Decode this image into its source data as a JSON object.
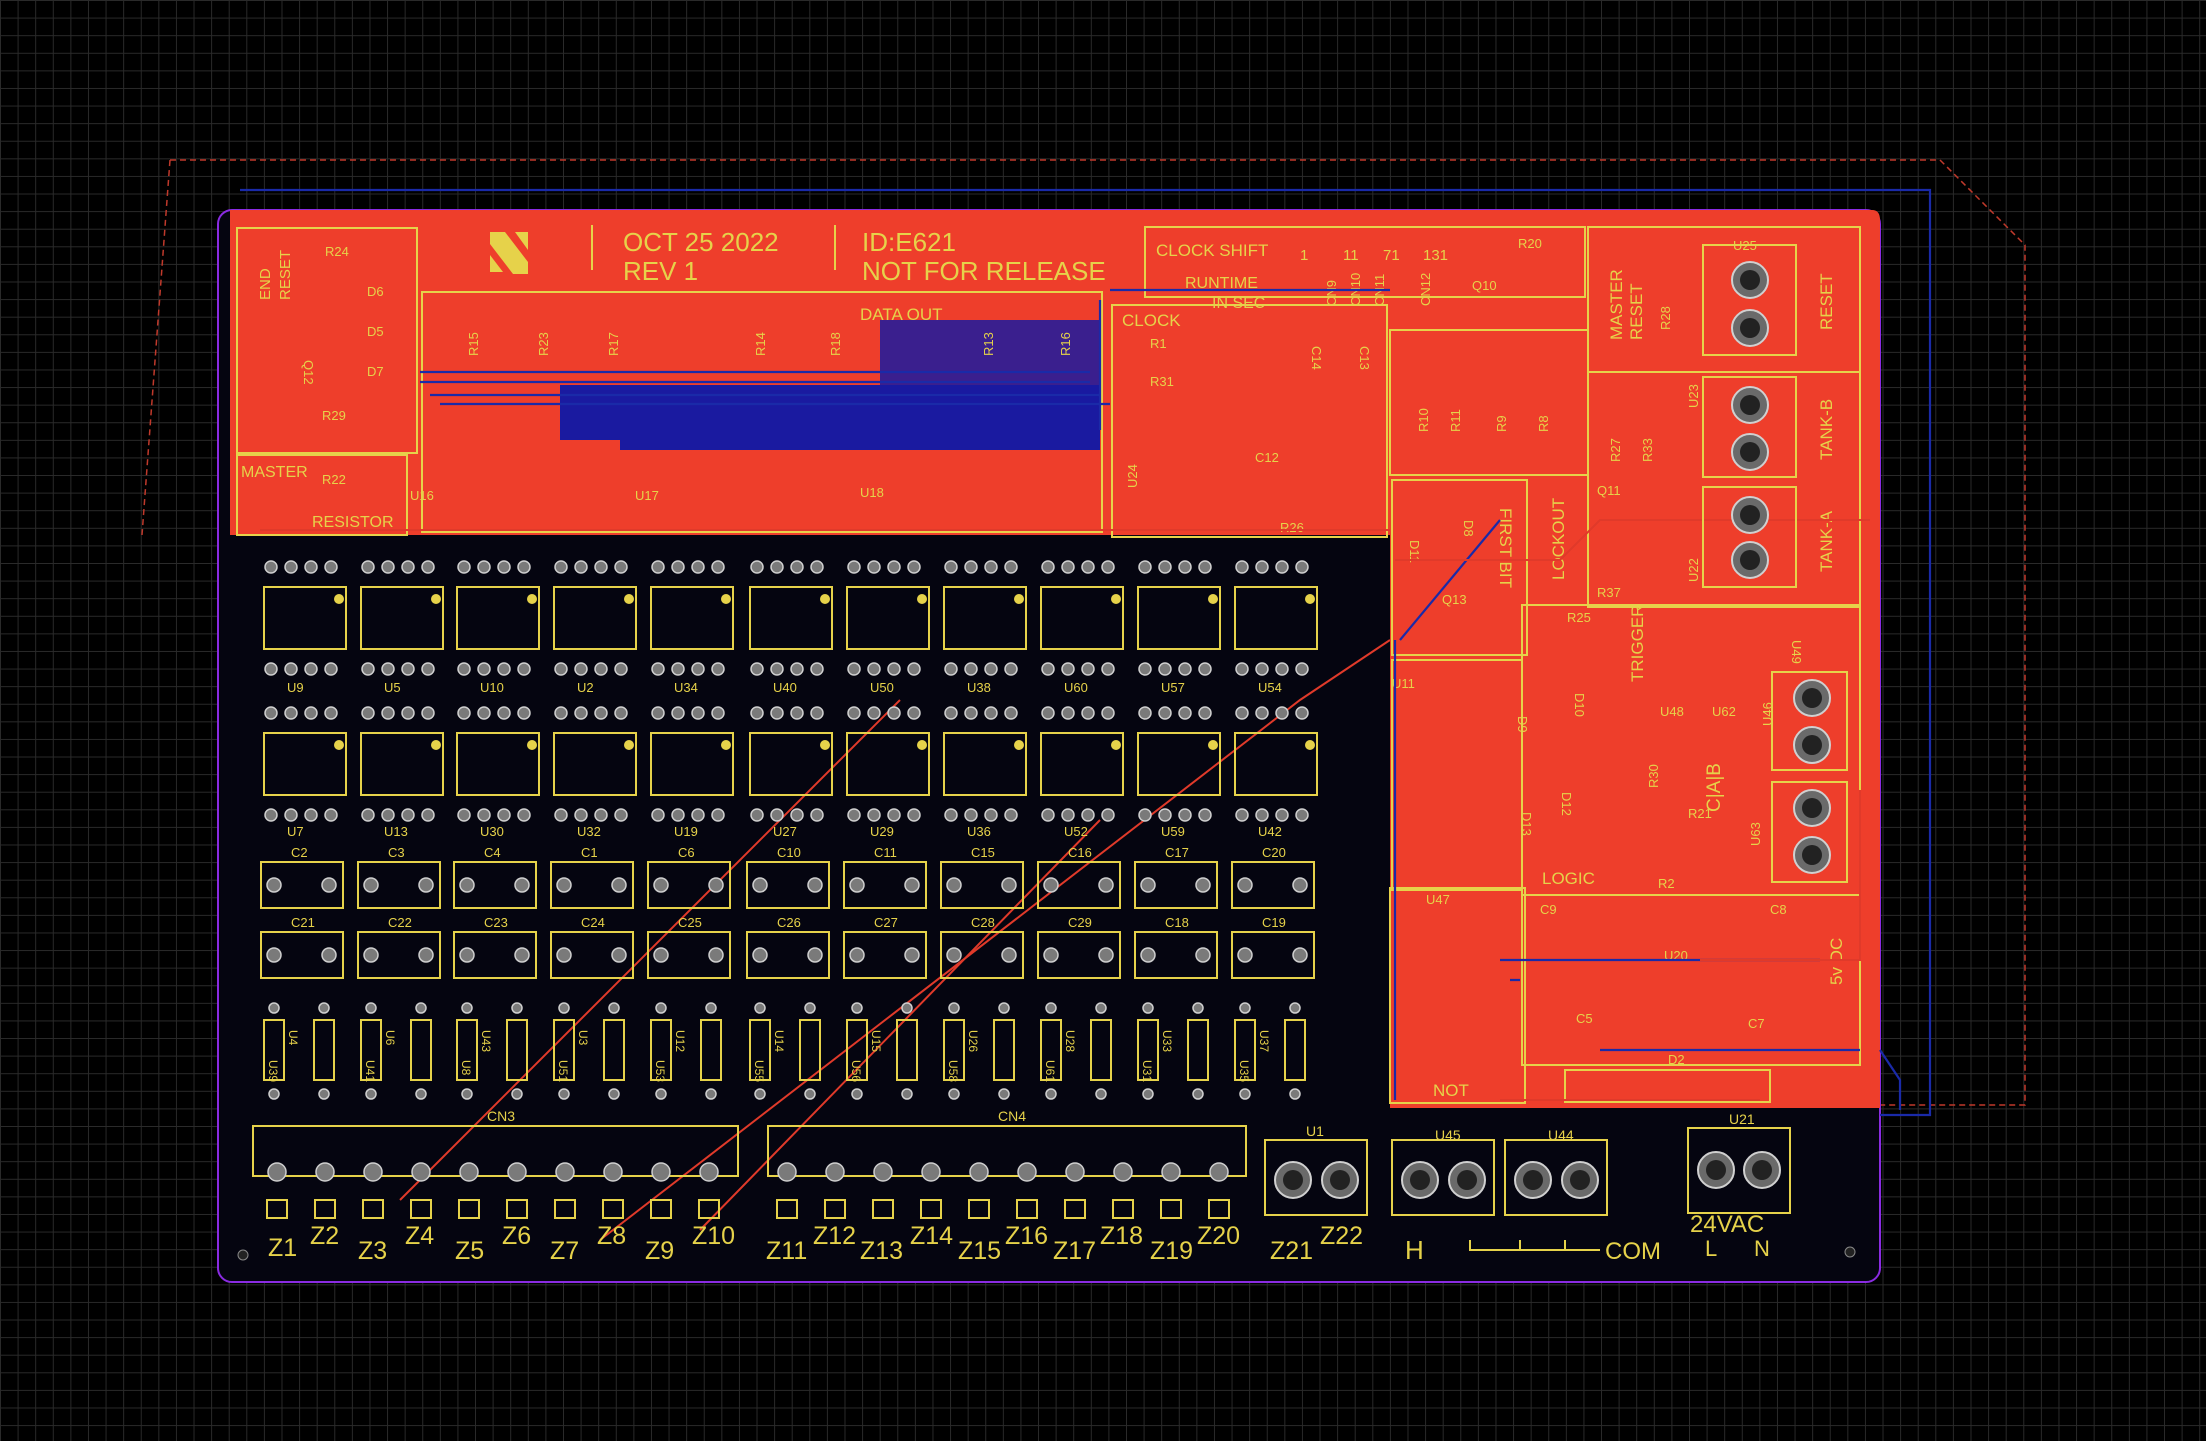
{
  "header": {
    "date": "OCT 25 2022",
    "rev": "REV 1",
    "id": "ID:E621",
    "release": "NOT FOR RELEASE"
  },
  "blocks": {
    "end_reset_a": "END",
    "end_reset_b": "RESET",
    "master_resistor_a": "MASTER",
    "master_resistor_b": "RESISTOR",
    "data_out": "DATA OUT",
    "clock_shift": "CLOCK SHIFT",
    "runtime_a": "RUNTIME",
    "runtime_b": "IN SEC",
    "runtime_values": [
      "1",
      "11",
      "71",
      "131"
    ],
    "clock": "CLOCK",
    "master_reset_a": "MASTER",
    "master_reset_b": "RESET",
    "reset": "RESET",
    "tank_b": "TANK-B",
    "tank_a": "TANK-A",
    "lockout": "LOCKOUT",
    "first_bit": "FIRST BIT",
    "trigger": "TRIGGER",
    "logic": "LOGIC",
    "not": "NOT",
    "vdc": "5v DC",
    "cab": "C|A|B"
  },
  "top_refs": {
    "r24": "R24",
    "d6": "D6",
    "d5": "D5",
    "d7": "D7",
    "q12": "Q12",
    "r29": "R29",
    "r22": "R22",
    "r15": "R15",
    "r23": "R23",
    "r17": "R17",
    "r14": "R14",
    "r18": "R18",
    "r13": "R13",
    "r16": "R16",
    "u16": "U16",
    "u17": "U17",
    "u18": "U18",
    "cn9": "CN9",
    "cn10": "CN10",
    "cn11": "CN11",
    "cn12": "CN12",
    "q10": "Q10",
    "r20": "R20",
    "r1": "R1",
    "r31": "R31",
    "c14": "C14",
    "c13": "C13",
    "c12": "C12",
    "u24": "U24",
    "r26": "R26",
    "r10": "R10",
    "r11": "R11",
    "r9": "R9",
    "r8": "R8",
    "r28": "R28",
    "u25": "U25",
    "r27": "R27",
    "r33": "R33",
    "u23": "U23",
    "q11": "Q11",
    "r37": "R37",
    "u22": "U22",
    "d11": "D11",
    "d8": "D8",
    "q13": "Q13",
    "r25": "R25",
    "u49": "U49",
    "u48": "U48",
    "u62": "U62",
    "u11": "U11",
    "d9": "D9",
    "d10": "D10",
    "d13": "D13",
    "d12": "D12",
    "u46": "U46",
    "r30": "R30",
    "r21": "R21",
    "r2": "R2",
    "u63": "U63",
    "u47": "U47",
    "c9": "C9",
    "c8": "C8",
    "u20": "U20",
    "c5": "C5",
    "c7": "C7",
    "d2": "D2"
  },
  "relay_row1_labels": [
    "U9",
    "U5",
    "U10",
    "U2",
    "U34",
    "U40",
    "U50",
    "U38",
    "U60",
    "U57",
    "U54"
  ],
  "relay_row2_labels": [
    "U7",
    "U13",
    "U30",
    "U32",
    "U19",
    "U27",
    "U29",
    "U36",
    "U52",
    "U59",
    "U42"
  ],
  "cap_row1_labels": [
    "C2",
    "C3",
    "C4",
    "C1",
    "C6",
    "C10",
    "C11",
    "C15",
    "C16",
    "C17",
    "C20"
  ],
  "cap_row2_labels": [
    "C21",
    "C22",
    "C23",
    "C24",
    "C25",
    "C26",
    "C27",
    "C28",
    "C29",
    "C18",
    "C19"
  ],
  "ic_top_labels": [
    "U4",
    "U6",
    "U43",
    "U3",
    "U12",
    "U14",
    "U15",
    "U26",
    "U28",
    "U33",
    "U37"
  ],
  "ic_bottom_labels": [
    "U39",
    "U41",
    "U8",
    "U51",
    "U53",
    "U55",
    "U56",
    "U58",
    "U61",
    "U31",
    "U35"
  ],
  "connectors": {
    "cn3": "CN3",
    "cn4": "CN4",
    "u1": "U1",
    "u45": "U45",
    "u44": "U44",
    "u21": "U21"
  },
  "zones": [
    "Z1",
    "Z2",
    "Z3",
    "Z4",
    "Z5",
    "Z6",
    "Z7",
    "Z8",
    "Z9",
    "Z10",
    "Z11",
    "Z12",
    "Z13",
    "Z14",
    "Z15",
    "Z16",
    "Z17",
    "Z18",
    "Z19",
    "Z20",
    "Z21",
    "Z22"
  ],
  "bottom_labels": {
    "h": "H",
    "com": "COM",
    "vac": "24VAC",
    "l": "L",
    "n": "N"
  },
  "colors": {
    "copper_top": "#ee3e2b",
    "copper_bottom": "#1a2aa8",
    "silkscreen": "#e6d24a",
    "outline": "#8a2be2"
  }
}
